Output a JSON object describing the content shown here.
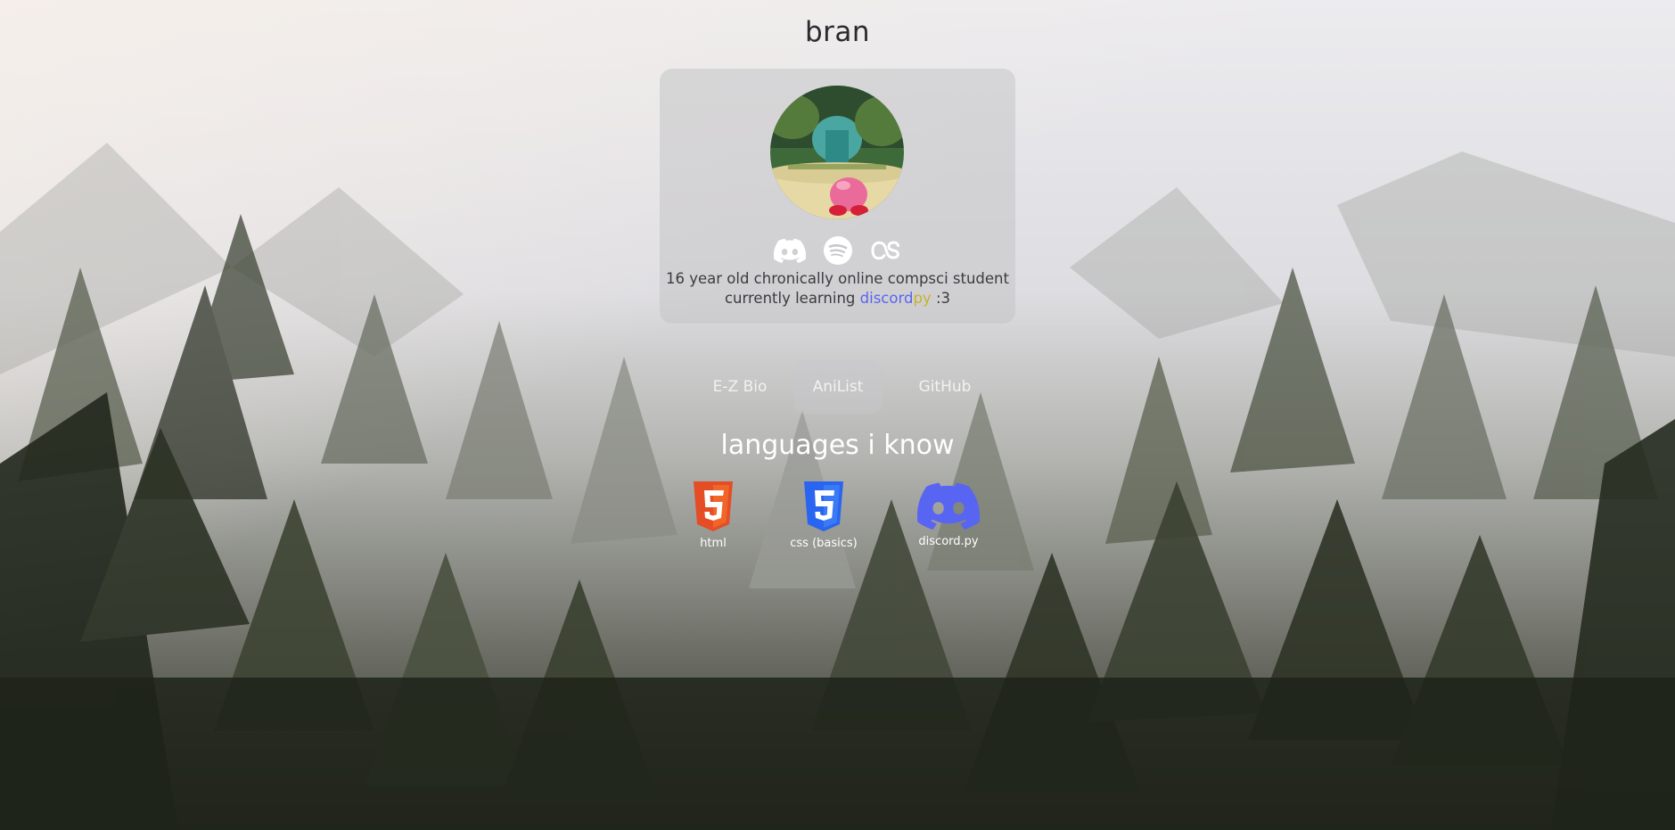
{
  "profile": {
    "name": "bran",
    "bio_line1": "16 year old chronically online compsci student",
    "bio_line2_prefix": "currently learning",
    "bio_highlight_discord": "discord",
    "bio_highlight_py": "py",
    "bio_line2_suffix": ":3"
  },
  "socials": [
    {
      "icon": "discord-icon"
    },
    {
      "icon": "spotify-icon"
    },
    {
      "icon": "lastfm-icon"
    }
  ],
  "links": [
    {
      "label": "E-Z Bio"
    },
    {
      "label": "AniList",
      "active": true
    },
    {
      "label": "GitHub"
    }
  ],
  "languages": {
    "heading": "languages i know",
    "items": [
      {
        "label": "html",
        "icon": "html5-icon",
        "color": "#e44d26"
      },
      {
        "label": "css (basics)",
        "icon": "css3-icon",
        "color": "#2965f1"
      },
      {
        "label": "discord.py",
        "icon": "discord-icon",
        "color": "#5865f2"
      }
    ]
  },
  "colors": {
    "discord": "#5865f2",
    "py_yellow": "#c8b22a"
  }
}
